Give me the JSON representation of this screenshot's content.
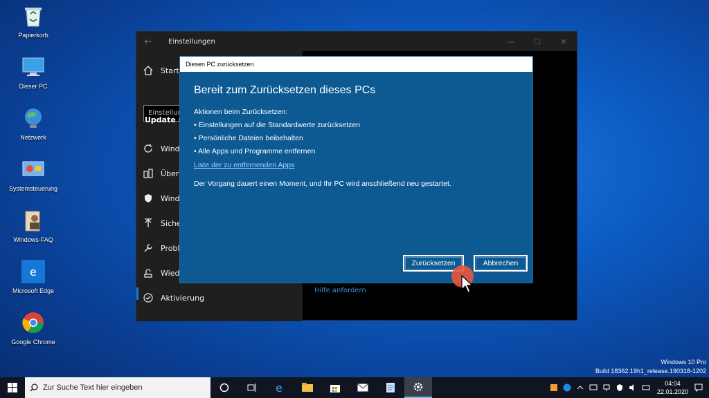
{
  "desktop": {
    "icons": [
      {
        "label": "Papierkorb",
        "icon": "recycle-bin-icon"
      },
      {
        "label": "Dieser PC",
        "icon": "computer-icon"
      },
      {
        "label": "Netzwerk",
        "icon": "network-icon"
      },
      {
        "label": "Systemsteuerung",
        "icon": "control-panel-icon"
      },
      {
        "label": "Windows-FAQ",
        "icon": "user-file-icon"
      },
      {
        "label": "Microsoft Edge",
        "icon": "edge-icon"
      },
      {
        "label": "Google Chrome",
        "icon": "chrome-icon"
      }
    ]
  },
  "settings": {
    "title": "Einstellungen",
    "sidebar": {
      "home": "Startse",
      "search_placeholder": "Einstellun",
      "section_heading": "Update un",
      "items": [
        {
          "label": "Windo",
          "icon": "refresh-icon"
        },
        {
          "label": "Übern",
          "icon": "delivery-icon"
        },
        {
          "label": "Windo",
          "icon": "shield-icon"
        },
        {
          "label": "Sicher",
          "icon": "backup-icon"
        },
        {
          "label": "Proble",
          "icon": "wrench-icon"
        },
        {
          "label": "Wiede",
          "icon": "recovery-icon"
        },
        {
          "label": "Aktivierung",
          "icon": "check-circle-icon"
        }
      ]
    },
    "help_link": "Hilfe anfordern"
  },
  "dialog": {
    "title": "Diesen PC zurücksetzen",
    "heading": "Bereit zum Zurücksetzen dieses PCs",
    "actions_label": "Aktionen beim Zurücksetzen:",
    "actions": [
      "• Einstellungen auf die Standardwerte zurücksetzen",
      "• Persönliche Dateien beibehalten",
      "• Alle Apps und Programme entfernen"
    ],
    "list_link": "Liste der zu entfernenden Apps",
    "note": "Der Vorgang dauert einen Moment, und Ihr PC wird anschließend neu gestartet.",
    "reset_button": "Zurücksetzen",
    "cancel_button": "Abbrechen"
  },
  "taskbar": {
    "search_placeholder": "Zur Suche Text hier eingeben",
    "apps": [
      "cortana-icon",
      "task-view-icon",
      "edge-icon",
      "file-explorer-icon",
      "store-icon",
      "mail-icon",
      "notepad-icon",
      "settings-gear-icon"
    ],
    "time": "04:04",
    "date": "22.01.2020"
  },
  "watermark": {
    "line1": "Windows 10 Pro",
    "line2": "Build 18362.19h1_release.190318-1202"
  },
  "colors": {
    "dialog_bg": "#0d5a93",
    "accent": "#0a84d6",
    "link": "#9fd0ff"
  }
}
